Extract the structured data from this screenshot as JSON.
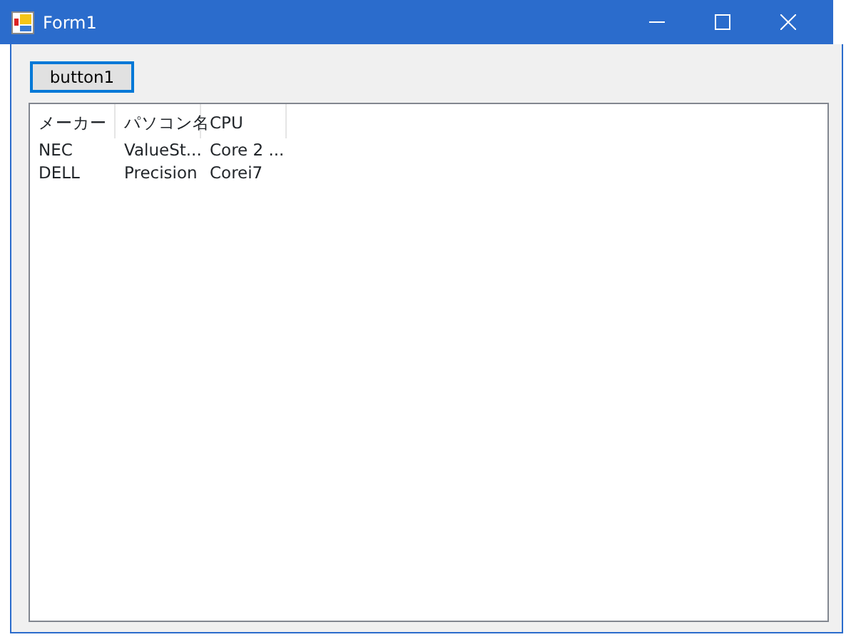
{
  "window": {
    "title": "Form1"
  },
  "button": {
    "label": "button1",
    "focused": true
  },
  "list_view": {
    "columns": [
      "メーカー",
      "パソコン名",
      "CPU"
    ],
    "rows": [
      [
        "NEC",
        "ValueSt...",
        "Core 2 ..."
      ],
      [
        "DELL",
        "Precision",
        "Corei7"
      ]
    ]
  }
}
